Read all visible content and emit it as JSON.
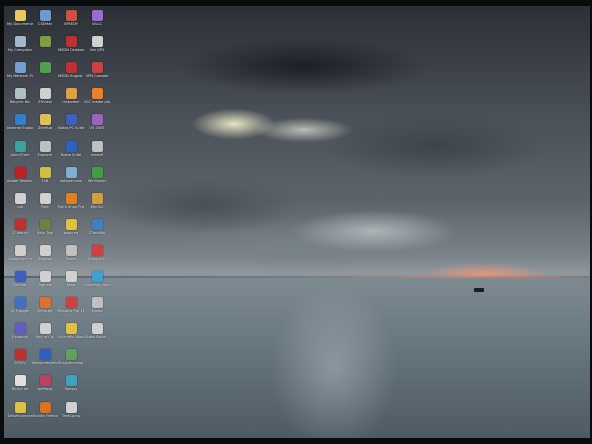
{
  "desktop": {
    "wallpaper": {
      "colors": {
        "sky_dark": "#2b2f36",
        "sky_light": "#8f989e",
        "sunset": "#c27d6e",
        "sea": "#6e7c85"
      }
    },
    "icons": [
      {
        "label": "My Documents",
        "icon": "folder-icon",
        "color": "#e8c860"
      },
      {
        "label": "CSEMat",
        "icon": "app-icon",
        "color": "#6a9ad0"
      },
      {
        "label": "SPEEDY",
        "icon": "app-icon",
        "color": "#d05040"
      },
      {
        "label": "VILLC",
        "icon": "app-icon",
        "color": "#9a6ad0"
      },
      {
        "label": "My Computer",
        "icon": "computer-icon",
        "color": "#a0b8d0"
      },
      {
        "label": "",
        "icon": "app-icon",
        "color": "#80a040"
      },
      {
        "label": "MSDN October 2003",
        "icon": "cd-icon",
        "color": "#c03030"
      },
      {
        "label": "Visi QPS",
        "icon": "app-icon",
        "color": "#d0d0d0"
      },
      {
        "label": "My Network Places",
        "icon": "network-icon",
        "color": "#70a0d0"
      },
      {
        "label": "",
        "icon": "app-icon",
        "color": "#50a050"
      },
      {
        "label": "MSDN August 2004",
        "icon": "cd-icon",
        "color": "#c03030"
      },
      {
        "label": "VPN Console",
        "icon": "app-icon",
        "color": "#d04040"
      },
      {
        "label": "Recycle Bin",
        "icon": "recycle-bin-icon",
        "color": "#b0c0c8"
      },
      {
        "label": "ZHView",
        "icon": "app-icon",
        "color": "#d0d0d0"
      },
      {
        "label": "mstudent",
        "icon": "app-icon",
        "color": "#e0a040"
      },
      {
        "label": "VLC media player",
        "icon": "vlc-icon",
        "color": "#f08020"
      },
      {
        "label": "Internet Explorer",
        "icon": "internet-explorer-icon",
        "color": "#3080d0"
      },
      {
        "label": "ZenHub",
        "icon": "app-icon",
        "color": "#e0c050"
      },
      {
        "label": "Nokia PC Suite",
        "icon": "app-icon",
        "color": "#4060c0"
      },
      {
        "label": "VS 2005",
        "icon": "app-icon",
        "color": "#a060c0"
      },
      {
        "label": "AlumiTime",
        "icon": "app-icon",
        "color": "#40a0a0"
      },
      {
        "label": "Explorer",
        "icon": "app-icon",
        "color": "#c0c0c0"
      },
      {
        "label": "Nokia Suite",
        "icon": "app-icon",
        "color": "#3060c0"
      },
      {
        "label": "winddf",
        "icon": "app-icon",
        "color": "#c0c0c0"
      },
      {
        "label": "Adobe Reader 8",
        "icon": "adobe-reader-icon",
        "color": "#c02020"
      },
      {
        "label": "F2B",
        "icon": "app-icon",
        "color": "#d0c040"
      },
      {
        "label": "notepad.exe",
        "icon": "app-icon",
        "color": "#80b0d0"
      },
      {
        "label": "WinStatus",
        "icon": "app-icon",
        "color": "#40a040"
      },
      {
        "label": "rob",
        "icon": "app-icon",
        "color": "#d0d0d0"
      },
      {
        "label": "PojIt",
        "icon": "app-icon",
        "color": "#d0d0d0"
      },
      {
        "label": "Paint Shop Pro 7",
        "icon": "app-icon",
        "color": "#e08020"
      },
      {
        "label": "Win32r",
        "icon": "app-icon",
        "color": "#d0a040"
      },
      {
        "label": "CCleaner",
        "icon": "app-icon",
        "color": "#c03030"
      },
      {
        "label": "Halo Trial",
        "icon": "app-icon",
        "color": "#708040"
      },
      {
        "label": "psbcreo",
        "icon": "app-icon",
        "color": "#e0c040"
      },
      {
        "label": "ZTreeWin",
        "icon": "app-icon",
        "color": "#4080c0"
      },
      {
        "label": "Clearpine Pro",
        "icon": "app-icon",
        "color": "#d0d0d0"
      },
      {
        "label": "Dogikon",
        "icon": "app-icon",
        "color": "#d0d0d0"
      },
      {
        "label": "Power",
        "icon": "app-icon",
        "color": "#c0c0c0"
      },
      {
        "label": "AcroWin11",
        "icon": "app-icon",
        "color": "#d04040"
      },
      {
        "label": "Defmar",
        "icon": "app-icon",
        "color": "#4060c0"
      },
      {
        "label": "Jingham",
        "icon": "app-icon",
        "color": "#d0d0d0"
      },
      {
        "label": "Keka",
        "icon": "app-icon",
        "color": "#d0d0d0"
      },
      {
        "label": "GameSpy Arcade",
        "icon": "app-icon",
        "color": "#40a0d0"
      },
      {
        "label": "DirFragger",
        "icon": "app-icon",
        "color": "#4070c0"
      },
      {
        "label": "3rFlutter",
        "icon": "app-icon",
        "color": "#e07030"
      },
      {
        "label": "Readiris Pro 11",
        "icon": "app-icon",
        "color": "#d04040"
      },
      {
        "label": "Kindle",
        "icon": "app-icon",
        "color": "#c0c0c0"
      },
      {
        "label": "Expando",
        "icon": "app-icon",
        "color": "#6060c0"
      },
      {
        "label": "Key of C#",
        "icon": "app-icon",
        "color": "#d0d0d0"
      },
      {
        "label": "Scientific WorkPlace 5.0",
        "icon": "app-icon",
        "color": "#e0c040"
      },
      {
        "label": "Stata Softw...",
        "icon": "app-icon",
        "color": "#d0d0d0"
      },
      {
        "label": "SPSSV",
        "icon": "app-icon",
        "color": "#c03030"
      },
      {
        "label": "Malwarebytes' Anti-Malware",
        "icon": "app-icon",
        "color": "#3060c0"
      },
      {
        "label": "SharpDevelop 2.0",
        "icon": "app-icon",
        "color": "#60a060"
      },
      {
        "label": "",
        "icon": "app-icon",
        "color": "#00000000"
      },
      {
        "label": "DirAct.txt",
        "icon": "text-file-icon",
        "color": "#e0e0e0"
      },
      {
        "label": "wpProgs",
        "icon": "app-icon",
        "color": "#c04060"
      },
      {
        "label": "Spessy",
        "icon": "app-icon",
        "color": "#40a0c0"
      },
      {
        "label": "",
        "icon": "app-icon",
        "color": "#00000000"
      },
      {
        "label": "DriveScanner",
        "icon": "app-icon",
        "color": "#e0c040"
      },
      {
        "label": "Mozilla Firefox",
        "icon": "firefox-icon",
        "color": "#e07020"
      },
      {
        "label": "TreeComp",
        "icon": "app-icon",
        "color": "#d0d0d0"
      }
    ]
  }
}
